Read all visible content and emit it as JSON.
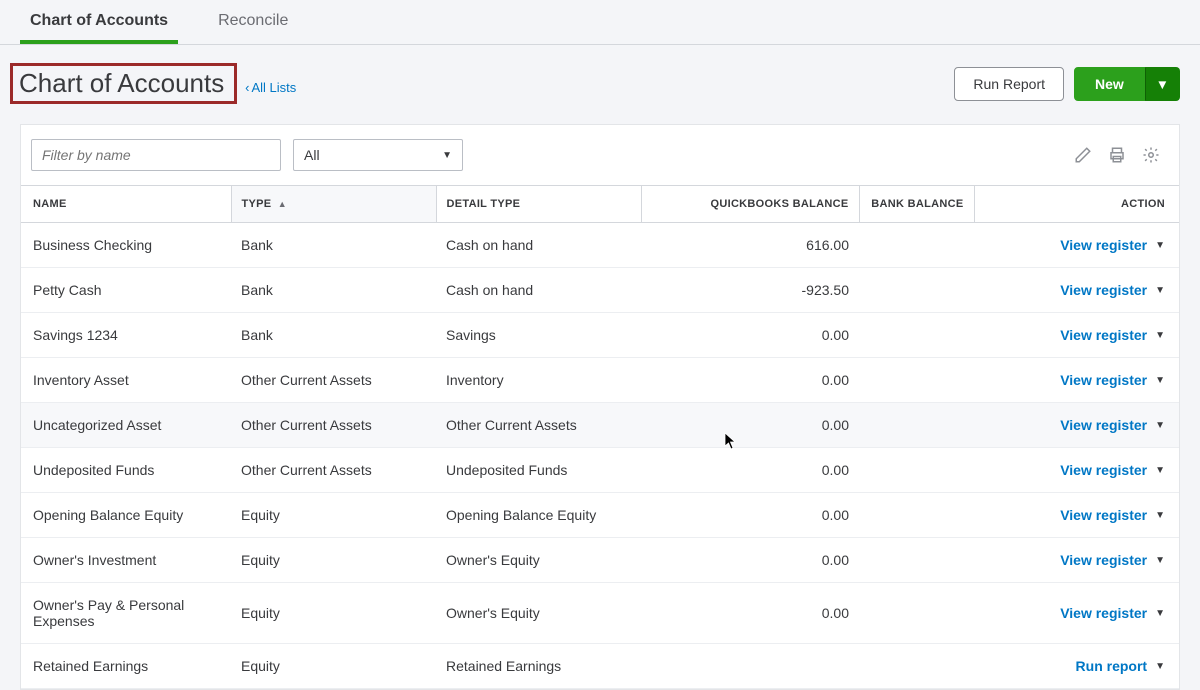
{
  "tabs": [
    {
      "label": "Chart of Accounts",
      "active": true
    },
    {
      "label": "Reconcile",
      "active": false
    }
  ],
  "page_title": "Chart of Accounts",
  "back_link": "All Lists",
  "buttons": {
    "run_report": "Run Report",
    "new": "New"
  },
  "filter": {
    "placeholder": "Filter by name",
    "dropdown_value": "All"
  },
  "columns": {
    "name": "NAME",
    "type": "TYPE",
    "detail_type": "DETAIL TYPE",
    "qb_balance": "QUICKBOOKS BALANCE",
    "bank_balance": "BANK BALANCE",
    "action": "ACTION"
  },
  "action_labels": {
    "view_register": "View register",
    "run_report": "Run report"
  },
  "rows": [
    {
      "name": "Business Checking",
      "type": "Bank",
      "detail": "Cash on hand",
      "qb": "616.00",
      "bank": "",
      "action": "view_register"
    },
    {
      "name": "Petty Cash",
      "type": "Bank",
      "detail": "Cash on hand",
      "qb": "-923.50",
      "bank": "",
      "action": "view_register"
    },
    {
      "name": "Savings 1234",
      "type": "Bank",
      "detail": "Savings",
      "qb": "0.00",
      "bank": "",
      "action": "view_register"
    },
    {
      "name": "Inventory Asset",
      "type": "Other Current Assets",
      "detail": "Inventory",
      "qb": "0.00",
      "bank": "",
      "action": "view_register"
    },
    {
      "name": "Uncategorized Asset",
      "type": "Other Current Assets",
      "detail": "Other Current Assets",
      "qb": "0.00",
      "bank": "",
      "action": "view_register",
      "hovered": true
    },
    {
      "name": "Undeposited Funds",
      "type": "Other Current Assets",
      "detail": "Undeposited Funds",
      "qb": "0.00",
      "bank": "",
      "action": "view_register"
    },
    {
      "name": "Opening Balance Equity",
      "type": "Equity",
      "detail": "Opening Balance Equity",
      "qb": "0.00",
      "bank": "",
      "action": "view_register"
    },
    {
      "name": "Owner's Investment",
      "type": "Equity",
      "detail": "Owner's Equity",
      "qb": "0.00",
      "bank": "",
      "action": "view_register"
    },
    {
      "name": "Owner's Pay & Personal Expenses",
      "type": "Equity",
      "detail": "Owner's Equity",
      "qb": "0.00",
      "bank": "",
      "action": "view_register"
    },
    {
      "name": "Retained Earnings",
      "type": "Equity",
      "detail": "Retained Earnings",
      "qb": "",
      "bank": "",
      "action": "run_report"
    }
  ]
}
